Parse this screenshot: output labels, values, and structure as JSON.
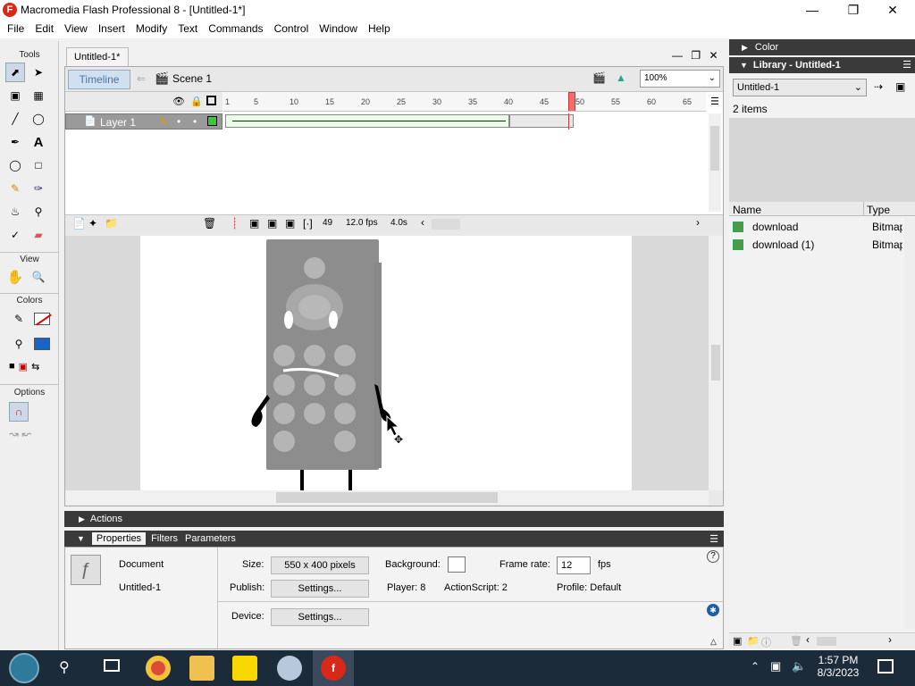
{
  "window": {
    "title": "Macromedia Flash Professional 8 - [Untitled-1*]",
    "logo": "F"
  },
  "menu": [
    "File",
    "Edit",
    "View",
    "Insert",
    "Modify",
    "Text",
    "Commands",
    "Control",
    "Window",
    "Help"
  ],
  "tools": {
    "section_tools": "Tools",
    "section_view": "View",
    "section_colors": "Colors",
    "section_options": "Options"
  },
  "document": {
    "tab": "Untitled-1*",
    "timeline_button": "Timeline",
    "scene": "Scene 1",
    "zoom": "100%",
    "layer_name": "Layer 1",
    "ruler": [
      "1",
      "5",
      "10",
      "15",
      "20",
      "25",
      "30",
      "35",
      "40",
      "45",
      "50",
      "55",
      "60",
      "65"
    ],
    "current_frame": "49",
    "fps": "12.0 fps",
    "time": "4.0s"
  },
  "panels": {
    "actions": "Actions",
    "tabs": [
      "Properties",
      "Filters",
      "Parameters"
    ]
  },
  "properties": {
    "kind": "Document",
    "name": "Untitled-1",
    "size_label": "Size:",
    "size_value": "550 x 400 pixels",
    "background_label": "Background:",
    "framerate_label": "Frame rate:",
    "framerate_value": "12",
    "fps": "fps",
    "publish_label": "Publish:",
    "settings": "Settings...",
    "player": "Player: 8",
    "actionscript": "ActionScript: 2",
    "profile": "Profile: Default",
    "device_label": "Device:"
  },
  "right": {
    "color_header": "Color",
    "library_header": "Library - Untitled-1",
    "library_select": "Untitled-1",
    "items_count": "2 items",
    "col_name": "Name",
    "col_type": "Type",
    "items": [
      {
        "name": "download",
        "type": "Bitmap"
      },
      {
        "name": "download (1)",
        "type": "Bitmap"
      }
    ]
  },
  "taskbar": {
    "time": "1:57 PM",
    "date": "8/3/2023"
  }
}
